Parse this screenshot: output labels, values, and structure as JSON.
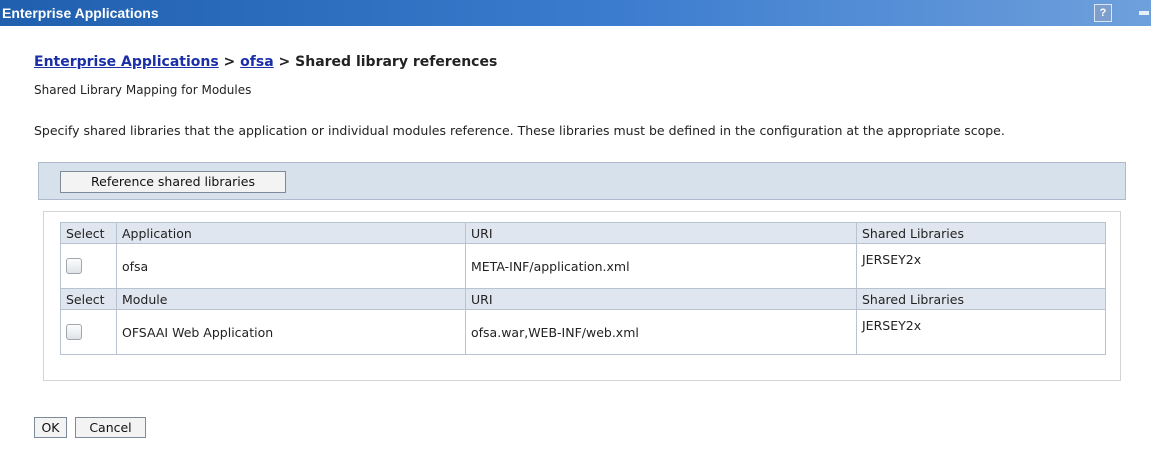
{
  "window": {
    "title": "Enterprise Applications",
    "help_label": "?"
  },
  "breadcrumb": {
    "link1": "Enterprise Applications",
    "sep1": " > ",
    "link2": "ofsa",
    "sep2": " > ",
    "current": "Shared library references"
  },
  "page": {
    "subtitle": "Shared Library Mapping for Modules",
    "description": "Specify shared libraries that the application or individual modules reference. These libraries must be defined in the configuration at the appropriate scope."
  },
  "toolbar": {
    "reference_button": "Reference shared libraries"
  },
  "table": {
    "sections": [
      {
        "headers": [
          "Select",
          "Application",
          "URI",
          "Shared Libraries"
        ],
        "row": {
          "name": "ofsa",
          "uri": "META-INF/application.xml",
          "libraries": "JERSEY2x",
          "checked": false
        }
      },
      {
        "headers": [
          "Select",
          "Module",
          "URI",
          "Shared Libraries"
        ],
        "row": {
          "name": "OFSAAI Web Application",
          "uri": "ofsa.war,WEB-INF/web.xml",
          "libraries": "JERSEY2x",
          "checked": false
        }
      }
    ]
  },
  "actions": {
    "ok": "OK",
    "cancel": "Cancel"
  },
  "icons": {
    "help": "help-icon",
    "minimize": "minimize-icon"
  },
  "colors": {
    "titlebar": "#1f5fae",
    "link": "#1a2fa8",
    "toolbar_bg": "#d7e1ec",
    "header_bg": "#e0e6ef"
  }
}
